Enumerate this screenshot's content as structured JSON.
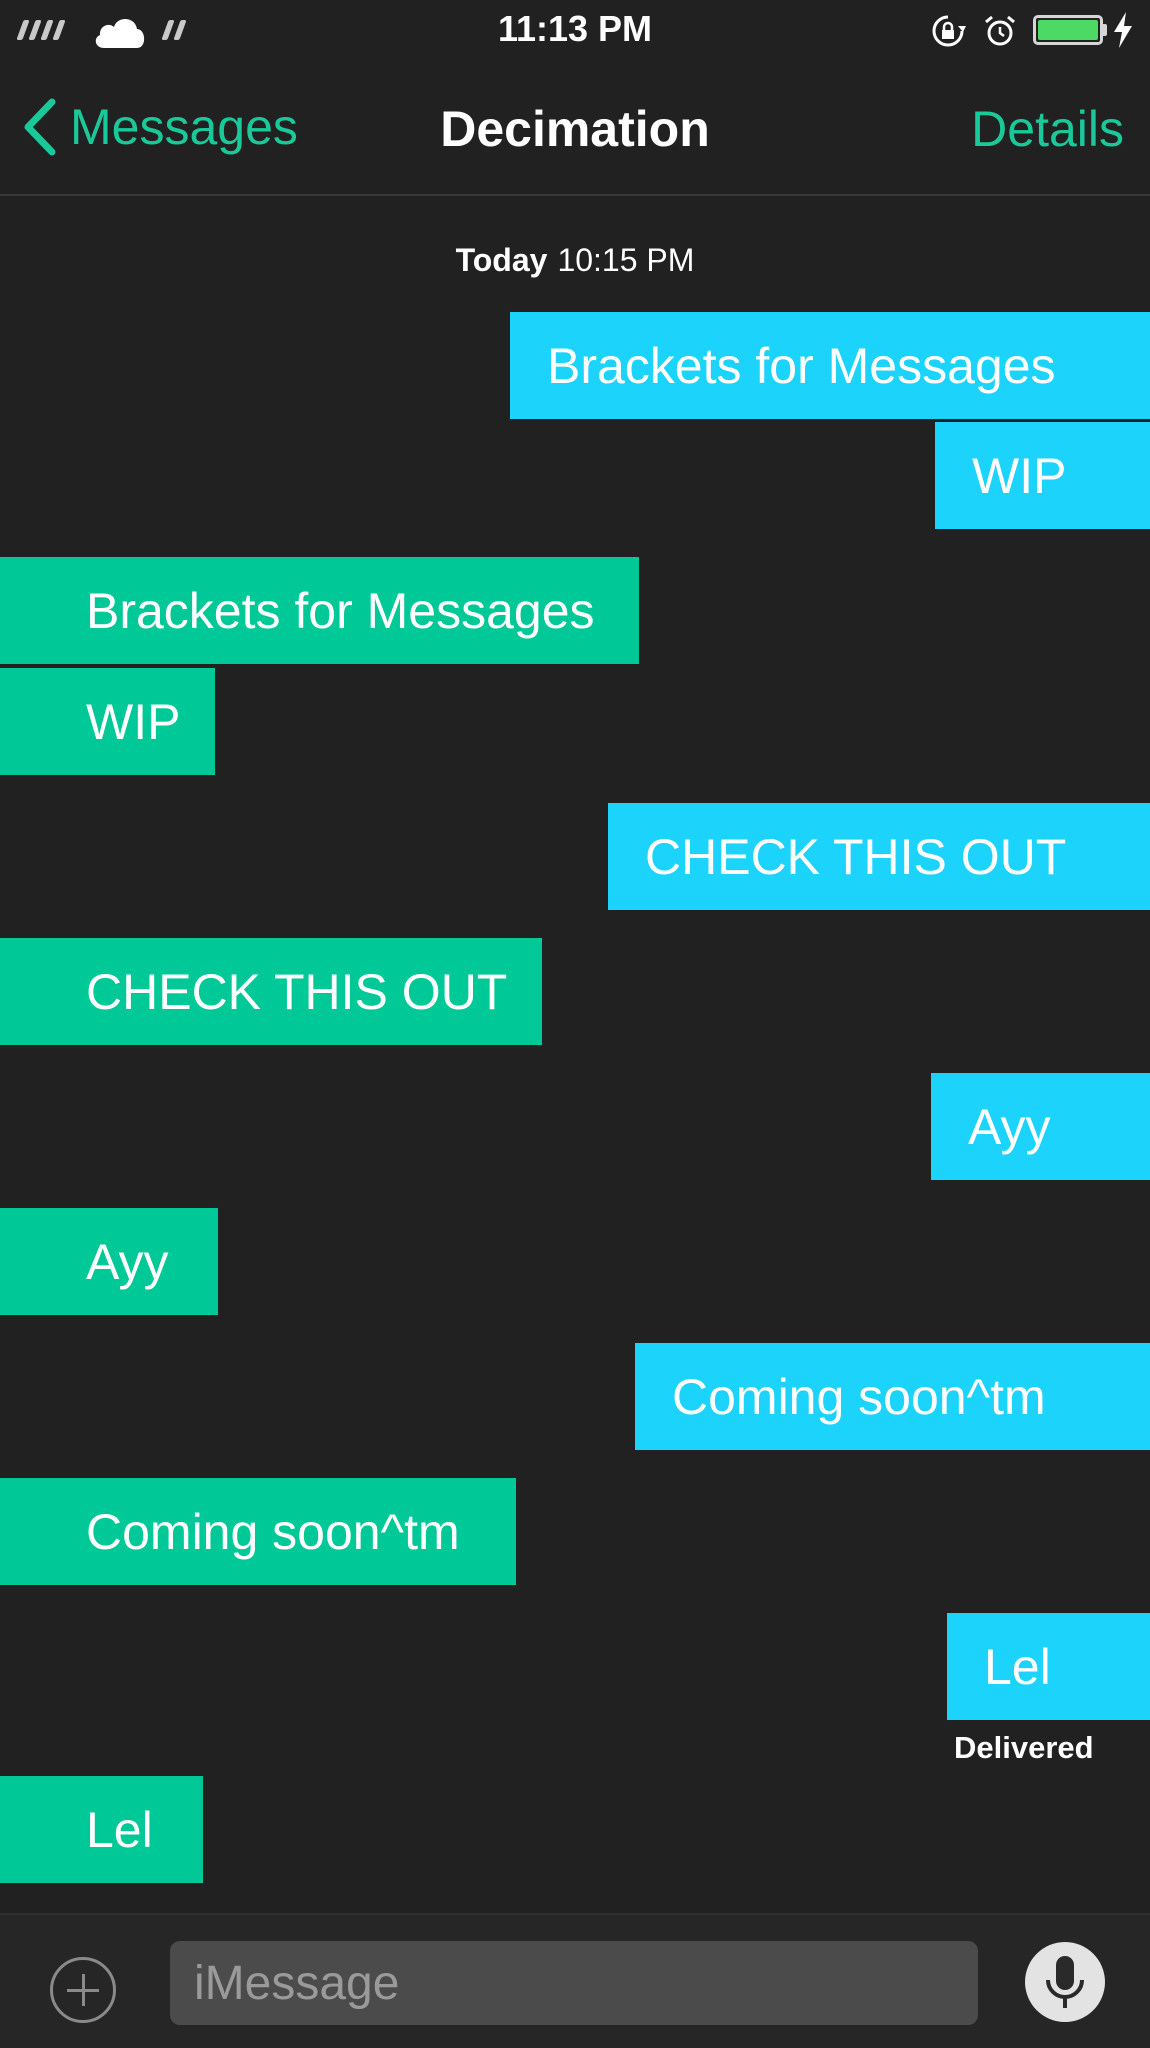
{
  "status_bar": {
    "time": "11:13 PM",
    "battery_level": 1.0,
    "icons": [
      "signal-icon",
      "cloud-icon",
      "wifi-icon",
      "orientation-lock-icon",
      "alarm-icon",
      "battery-icon",
      "charging-bolt-icon"
    ]
  },
  "nav": {
    "back_label": "Messages",
    "title": "Decimation",
    "details_label": "Details",
    "accent_color": "#1ac99a"
  },
  "conversation": {
    "timestamp_day": "Today",
    "timestamp_time": "10:15 PM",
    "outgoing_color": "#1cd3fb",
    "incoming_color": "#00c896",
    "messages": [
      {
        "direction": "outgoing",
        "text": "Brackets for Messages"
      },
      {
        "direction": "outgoing",
        "text": "WIP"
      },
      {
        "direction": "incoming",
        "text": "Brackets for Messages"
      },
      {
        "direction": "incoming",
        "text": "WIP"
      },
      {
        "direction": "outgoing",
        "text": "CHECK THIS OUT"
      },
      {
        "direction": "incoming",
        "text": "CHECK THIS OUT"
      },
      {
        "direction": "outgoing",
        "text": "Ayy"
      },
      {
        "direction": "incoming",
        "text": "Ayy"
      },
      {
        "direction": "outgoing",
        "text": "Coming soon^tm"
      },
      {
        "direction": "incoming",
        "text": "Coming soon^tm"
      },
      {
        "direction": "outgoing",
        "text": "Lel"
      },
      {
        "direction": "incoming",
        "text": "Lel"
      }
    ],
    "delivered_label": "Delivered"
  },
  "input_bar": {
    "placeholder": "iMessage",
    "value": ""
  }
}
